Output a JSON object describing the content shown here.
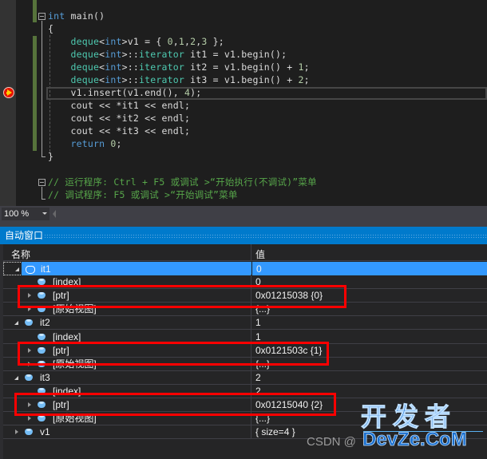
{
  "editor": {
    "lines": [
      {
        "tokens": [
          {
            "t": "int",
            "c": "kw"
          },
          {
            "t": " main()",
            "c": ""
          }
        ]
      },
      {
        "tokens": [
          {
            "t": "{",
            "c": ""
          }
        ]
      },
      {
        "tokens": [
          {
            "t": "    ",
            "c": ""
          },
          {
            "t": "deque",
            "c": "ty"
          },
          {
            "t": "<",
            "c": ""
          },
          {
            "t": "int",
            "c": "kw"
          },
          {
            "t": ">v1 = { ",
            "c": ""
          },
          {
            "t": "0",
            "c": "num"
          },
          {
            "t": ",",
            "c": ""
          },
          {
            "t": "1",
            "c": "num"
          },
          {
            "t": ",",
            "c": ""
          },
          {
            "t": "2",
            "c": "num"
          },
          {
            "t": ",",
            "c": ""
          },
          {
            "t": "3",
            "c": "num"
          },
          {
            "t": " };",
            "c": ""
          }
        ]
      },
      {
        "tokens": [
          {
            "t": "    ",
            "c": ""
          },
          {
            "t": "deque",
            "c": "ty"
          },
          {
            "t": "<",
            "c": ""
          },
          {
            "t": "int",
            "c": "kw"
          },
          {
            "t": ">::",
            "c": ""
          },
          {
            "t": "iterator",
            "c": "ty"
          },
          {
            "t": " it1 = v1.begin();",
            "c": ""
          }
        ]
      },
      {
        "tokens": [
          {
            "t": "    ",
            "c": ""
          },
          {
            "t": "deque",
            "c": "ty"
          },
          {
            "t": "<",
            "c": ""
          },
          {
            "t": "int",
            "c": "kw"
          },
          {
            "t": ">::",
            "c": ""
          },
          {
            "t": "iterator",
            "c": "ty"
          },
          {
            "t": " it2 = v1.begin() + ",
            "c": ""
          },
          {
            "t": "1",
            "c": "num"
          },
          {
            "t": ";",
            "c": ""
          }
        ]
      },
      {
        "tokens": [
          {
            "t": "    ",
            "c": ""
          },
          {
            "t": "deque",
            "c": "ty"
          },
          {
            "t": "<",
            "c": ""
          },
          {
            "t": "int",
            "c": "kw"
          },
          {
            "t": ">::",
            "c": ""
          },
          {
            "t": "iterator",
            "c": "ty"
          },
          {
            "t": " it3 = v1.begin() + ",
            "c": ""
          },
          {
            "t": "2",
            "c": "num"
          },
          {
            "t": ";",
            "c": ""
          }
        ]
      },
      {
        "tokens": [
          {
            "t": "    v1.insert(v1.end(), ",
            "c": ""
          },
          {
            "t": "4",
            "c": "num"
          },
          {
            "t": ");",
            "c": ""
          }
        ]
      },
      {
        "tokens": [
          {
            "t": "    cout << *it1 << endl;",
            "c": ""
          }
        ]
      },
      {
        "tokens": [
          {
            "t": "    cout << *it2 << endl;",
            "c": ""
          }
        ]
      },
      {
        "tokens": [
          {
            "t": "    cout << *it3 << endl;",
            "c": ""
          }
        ]
      },
      {
        "tokens": [
          {
            "t": "    ",
            "c": ""
          },
          {
            "t": "return",
            "c": "kw"
          },
          {
            "t": " ",
            "c": ""
          },
          {
            "t": "0",
            "c": "num"
          },
          {
            "t": ";",
            "c": ""
          }
        ]
      },
      {
        "tokens": [
          {
            "t": "}",
            "c": ""
          }
        ]
      },
      {
        "tokens": []
      },
      {
        "tokens": [
          {
            "t": "// 运行程序: Ctrl + F5 或调试 >“开始执行(不调试)”菜单",
            "c": "cm"
          }
        ]
      },
      {
        "tokens": [
          {
            "t": "// 调试程序: F5 或调试 >“开始调试”菜单",
            "c": "cm"
          }
        ]
      }
    ],
    "current_line_index": 6
  },
  "statusbar": {
    "zoom_value": "100 %"
  },
  "autos": {
    "title": "自动窗口",
    "columns": {
      "name": "名称",
      "value": "值"
    },
    "rows": [
      {
        "name": "it1",
        "value": "0",
        "level": 0,
        "expander": "open",
        "selected": true
      },
      {
        "name": "[index]",
        "value": "0",
        "level": 1,
        "expander": "none"
      },
      {
        "name": "[ptr]",
        "value": "0x01215038 {0}",
        "level": 1,
        "expander": "closed",
        "highlighted": true
      },
      {
        "name": "[原始视图]",
        "value": "{...}",
        "level": 1,
        "expander": "closed"
      },
      {
        "name": "it2",
        "value": "1",
        "level": 0,
        "expander": "open"
      },
      {
        "name": "[index]",
        "value": "1",
        "level": 1,
        "expander": "none"
      },
      {
        "name": "[ptr]",
        "value": "0x0121503c {1}",
        "level": 1,
        "expander": "closed",
        "highlighted": true
      },
      {
        "name": "[原始视图]",
        "value": "{...}",
        "level": 1,
        "expander": "closed"
      },
      {
        "name": "it3",
        "value": "2",
        "level": 0,
        "expander": "open"
      },
      {
        "name": "[index]",
        "value": "2",
        "level": 1,
        "expander": "none"
      },
      {
        "name": "[ptr]",
        "value": "0x01215040 {2}",
        "level": 1,
        "expander": "closed",
        "highlighted": true
      },
      {
        "name": "[原始视图]",
        "value": "{...}",
        "level": 1,
        "expander": "closed"
      },
      {
        "name": "v1",
        "value": "{ size=4 }",
        "level": 0,
        "expander": "closed"
      }
    ]
  },
  "watermark": {
    "csdn": "CSDN @",
    "brand_cn": "开发者",
    "brand_en": "DevZe.CoM"
  }
}
